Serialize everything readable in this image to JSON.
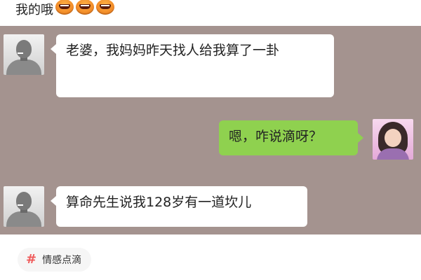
{
  "caption": {
    "text": "我的哦",
    "emoji_icon": "grimacing-face-icon",
    "emoji_count": 3
  },
  "chat": {
    "background_color": "#a4938f",
    "messages": [
      {
        "side": "left",
        "avatar": "man-avatar",
        "text": "老婆，我妈妈昨天找人给我算了一卦"
      },
      {
        "side": "right",
        "avatar": "girl-avatar",
        "text": "嗯，咋说滴呀？"
      },
      {
        "side": "left",
        "avatar": "man-avatar",
        "text": "算命先生说我128岁有一道坎儿"
      }
    ],
    "colors": {
      "incoming_bubble": "#ffffff",
      "outgoing_bubble": "#8fd14f"
    }
  },
  "tag": {
    "icon": "hash-icon",
    "label": "情感点滴"
  }
}
